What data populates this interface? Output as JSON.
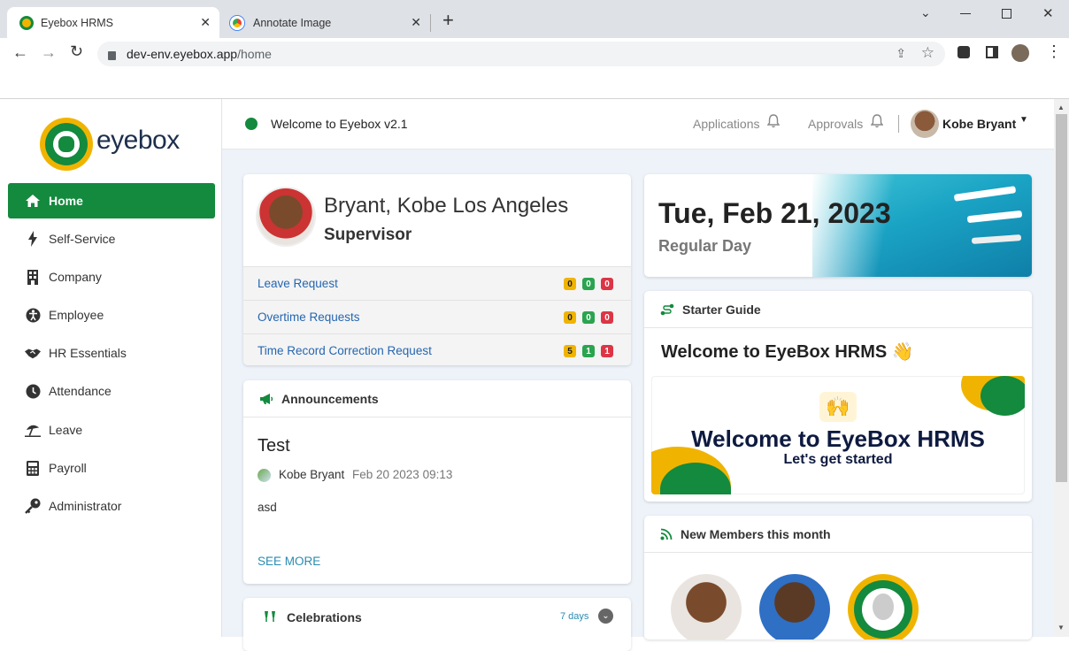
{
  "browser": {
    "tabs": [
      {
        "title": "Eyebox HRMS",
        "active": true
      },
      {
        "title": "Annotate Image",
        "active": false
      }
    ],
    "new_tab": "+",
    "url_host": "dev-env.eyebox.app",
    "url_path": "/home"
  },
  "sidebar": {
    "logo_text": "eyebox",
    "items": [
      {
        "label": "Home",
        "icon": "home-icon",
        "active": true
      },
      {
        "label": "Self-Service",
        "icon": "bolt-icon"
      },
      {
        "label": "Company",
        "icon": "building-icon"
      },
      {
        "label": "Employee",
        "icon": "accessibility-icon"
      },
      {
        "label": "HR Essentials",
        "icon": "handshake-icon"
      },
      {
        "label": "Attendance",
        "icon": "clock-icon"
      },
      {
        "label": "Leave",
        "icon": "umbrella-beach-icon"
      },
      {
        "label": "Payroll",
        "icon": "calculator-icon"
      },
      {
        "label": "Administrator",
        "icon": "key-icon"
      }
    ]
  },
  "topnav": {
    "welcome": "Welcome to Eyebox v2.1",
    "applications": "Applications",
    "approvals": "Approvals",
    "user_name": "Kobe Bryant"
  },
  "profile": {
    "name": "Bryant, Kobe Los Angeles",
    "role": "Supervisor",
    "requests": [
      {
        "label": "Leave Request",
        "counts": [
          "0",
          "0",
          "0"
        ]
      },
      {
        "label": "Overtime Requests",
        "counts": [
          "0",
          "0",
          "0"
        ]
      },
      {
        "label": "Time Record Correction Request",
        "counts": [
          "5",
          "1",
          "1"
        ]
      }
    ]
  },
  "announcements": {
    "header": "Announcements",
    "title": "Test",
    "author": "Kobe Bryant",
    "date": "Feb 20 2023 09:13",
    "body": "asd",
    "see_more": "SEE MORE"
  },
  "celebrations": {
    "header": "Celebrations",
    "range": "7 days"
  },
  "date_card": {
    "date": "Tue, Feb 21, 2023",
    "day_type": "Regular Day"
  },
  "starter_guide": {
    "header": "Starter Guide",
    "title": "Welcome to EyeBox HRMS 👋",
    "banner_title": "Welcome to EyeBox HRMS",
    "banner_sub": "Let's get started"
  },
  "new_members": {
    "header": "New Members this month"
  },
  "colors": {
    "brand_green": "#138a3e",
    "brand_yellow": "#f0b400",
    "link_blue": "#2566b0",
    "badge_red": "#dc3545"
  }
}
